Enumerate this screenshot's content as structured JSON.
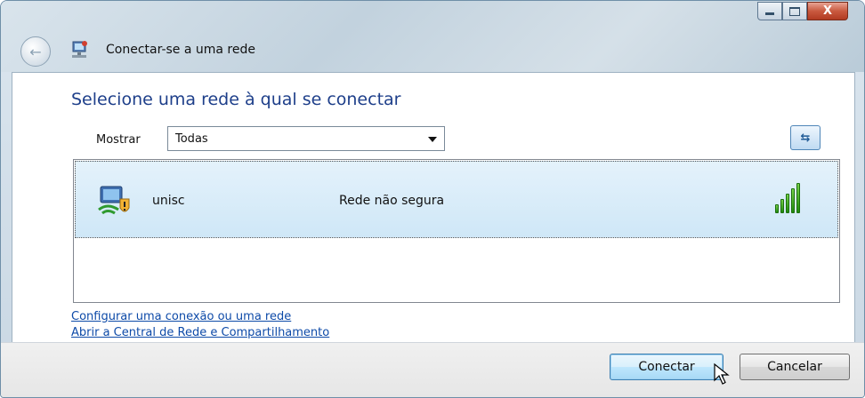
{
  "window": {
    "title": "Conectar-se a uma rede",
    "controls": {
      "minimize": "minimize-icon",
      "maximize": "maximize-icon",
      "close": "close-icon",
      "close_glyph": "X"
    }
  },
  "toolbar": {
    "back_glyph": "←"
  },
  "main": {
    "heading": "Selecione uma rede à qual se conectar",
    "filter": {
      "label": "Mostrar",
      "value": "Todas"
    },
    "refresh_glyph": "⇆"
  },
  "networks": [
    {
      "name": "unisc",
      "status": "Rede não segura",
      "signal_level": 5,
      "signal_max": 5
    }
  ],
  "links": {
    "setup": "Configurar uma conexão ou uma rede",
    "center": "Abrir a Central de Rede e Compartilhamento"
  },
  "buttons": {
    "connect": "Conectar",
    "cancel": "Cancelar"
  },
  "colors": {
    "heading": "#1e3f8a",
    "link": "#0d4aa8",
    "selection": "#cfe7f7",
    "signal": "#1f8a0c"
  }
}
